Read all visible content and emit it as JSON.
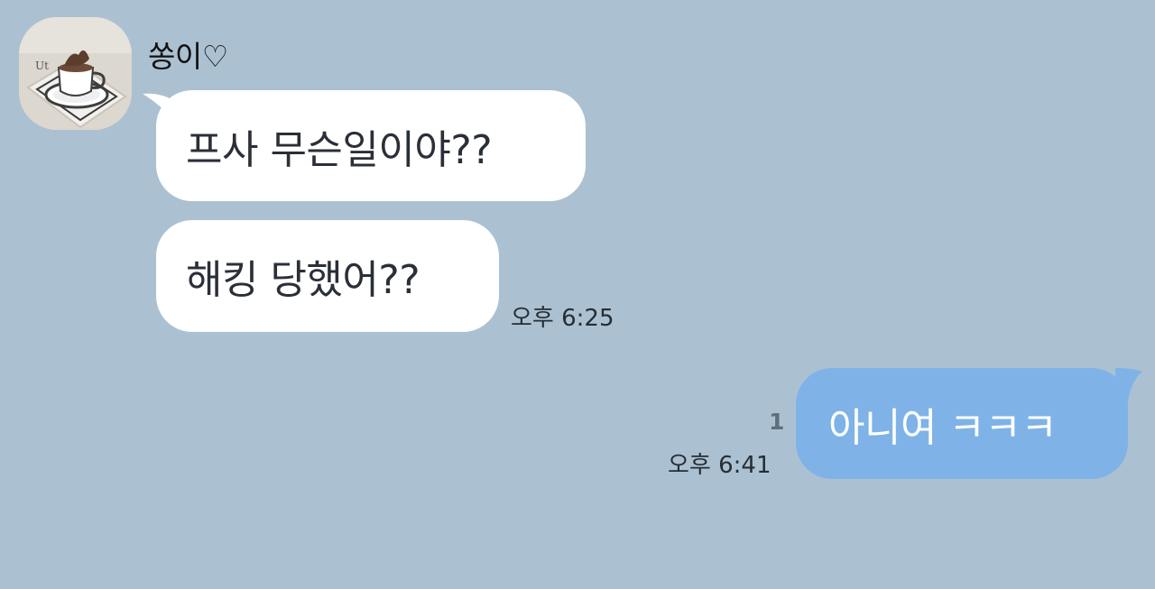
{
  "chat": {
    "contact_name": "쏭이♡",
    "avatar": "teacup-photo",
    "colors": {
      "background": "#abc1d1",
      "incoming_bubble": "#ffffff",
      "outgoing_bubble": "#7fb3e7"
    },
    "messages": [
      {
        "direction": "incoming",
        "text": "프사 무슨일이야??"
      },
      {
        "direction": "incoming",
        "text": "해킹 당했어??",
        "time": "오후 6:25"
      },
      {
        "direction": "outgoing",
        "text": "아니여 ㅋㅋㅋ",
        "time": "오후 6:41",
        "unread_count": "1"
      }
    ]
  }
}
